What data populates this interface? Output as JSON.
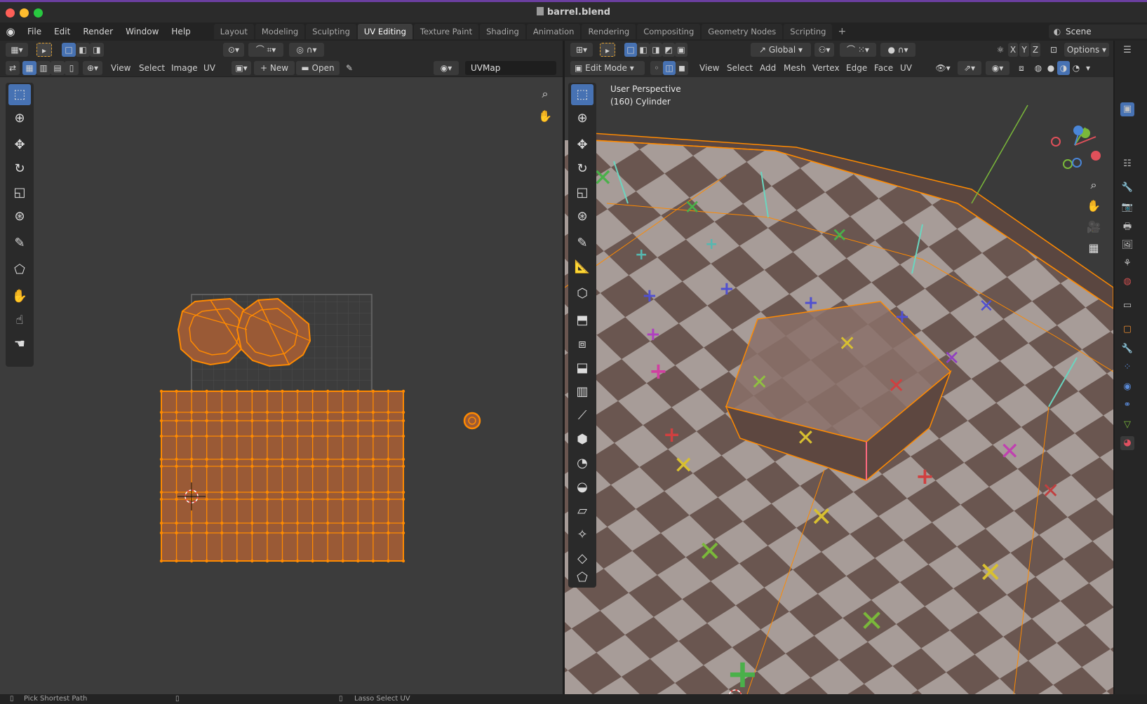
{
  "window": {
    "title": "barrel.blend"
  },
  "menu": [
    "File",
    "Edit",
    "Render",
    "Window",
    "Help"
  ],
  "workspaces": [
    {
      "label": "Layout",
      "active": false
    },
    {
      "label": "Modeling",
      "active": false
    },
    {
      "label": "Sculpting",
      "active": false
    },
    {
      "label": "UV Editing",
      "active": true
    },
    {
      "label": "Texture Paint",
      "active": false
    },
    {
      "label": "Shading",
      "active": false
    },
    {
      "label": "Animation",
      "active": false
    },
    {
      "label": "Rendering",
      "active": false
    },
    {
      "label": "Compositing",
      "active": false
    },
    {
      "label": "Geometry Nodes",
      "active": false
    },
    {
      "label": "Scripting",
      "active": false
    }
  ],
  "scene": {
    "label": "Scene"
  },
  "uv_editor": {
    "menus": [
      "View",
      "Select",
      "Image",
      "UV"
    ],
    "new_label": "New",
    "open_label": "Open",
    "uvmap_name": "UVMap"
  },
  "viewport": {
    "orientation": "Global",
    "options_label": "Options",
    "mode": "Edit Mode",
    "menus": [
      "View",
      "Select",
      "Add",
      "Mesh",
      "Vertex",
      "Edge",
      "Face",
      "UV"
    ],
    "info_line1": "User Perspective",
    "info_line2": "(160) Cylinder",
    "axes": {
      "x": "X",
      "y": "Y",
      "z": "Z"
    }
  },
  "status": {
    "left": "Pick Shortest Path",
    "middle": "Lasso Select UV"
  },
  "colors": {
    "accent": "#4772b3",
    "selection": "#ff8a00",
    "uv_face": "#9a5a36"
  }
}
